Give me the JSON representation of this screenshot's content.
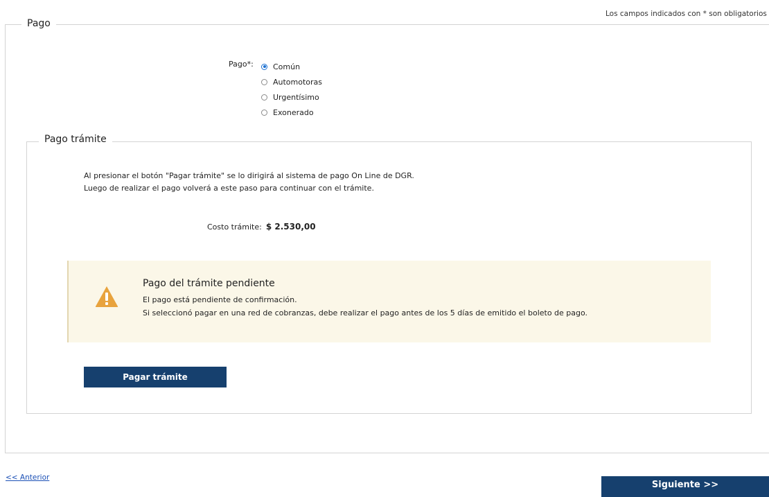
{
  "header": {
    "required_note": "Los campos indicados con * son obligatorios"
  },
  "pago": {
    "legend": "Pago",
    "label": "Pago*:",
    "options": [
      "Común",
      "Automotoras",
      "Urgentísimo",
      "Exonerado"
    ],
    "selected": "Común"
  },
  "pago_tramite": {
    "legend": "Pago trámite",
    "info_line1": "Al presionar el botón \"Pagar trámite\" se lo dirigirá al sistema de pago On Line de DGR.",
    "info_line2": "Luego de realizar el pago volverá a este paso para continuar con el trámite.",
    "cost_label": "Costo trámite:",
    "cost_value": "$ 2.530,00",
    "alert": {
      "title": "Pago del trámite pendiente",
      "line1": "El pago está pendiente de confirmación.",
      "line2": "Si seleccionó pagar en una red de cobranzas, debe realizar el pago antes de los 5 días de emitido el boleto de pago.",
      "icon": "warning-icon",
      "icon_color": "#e8a33d"
    },
    "pay_button": "Pagar trámite"
  },
  "nav": {
    "prev_label": "<< Anterior",
    "next_label": "Siguiente >>"
  },
  "colors": {
    "button_bg": "#16406e",
    "alert_bg": "#fbf7e8",
    "radio_accent": "#1a6fd1"
  }
}
